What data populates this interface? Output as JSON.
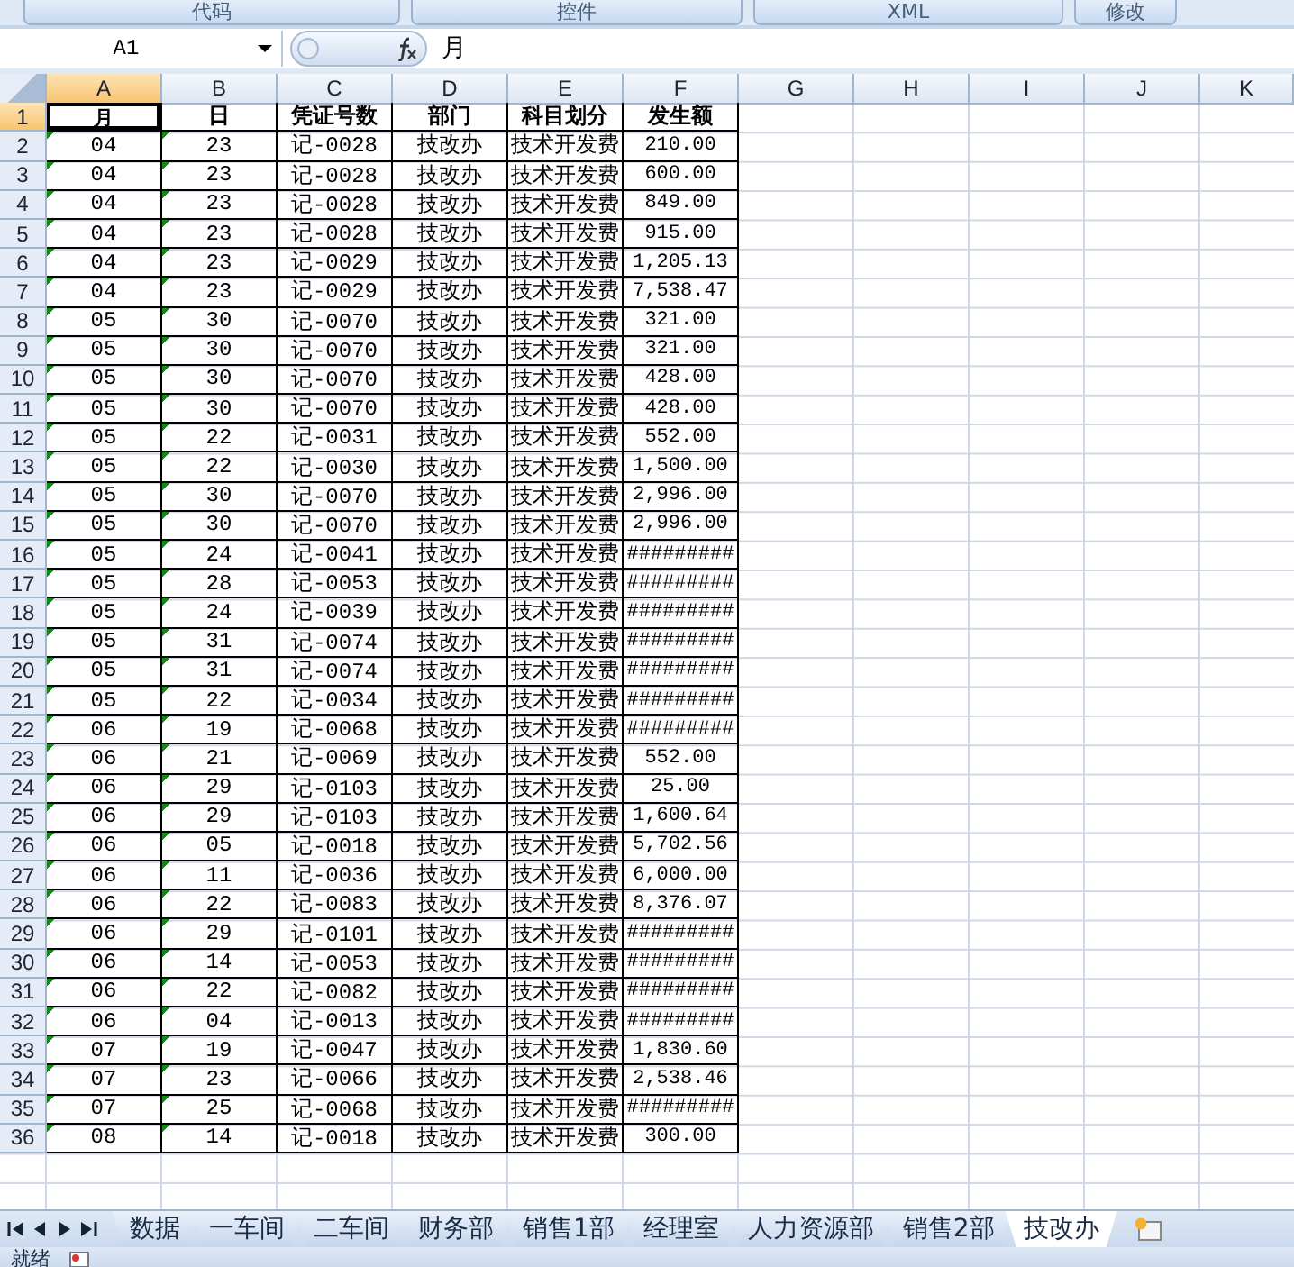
{
  "ribbon_buttons": [
    "代码",
    "控件",
    "XML",
    "修改"
  ],
  "name_box": "A1",
  "formula": "月",
  "columns": [
    {
      "label": "A",
      "selected": true
    },
    {
      "label": "B",
      "selected": false
    },
    {
      "label": "C",
      "selected": false
    },
    {
      "label": "D",
      "selected": false
    },
    {
      "label": "E",
      "selected": false
    },
    {
      "label": "F",
      "selected": false
    },
    {
      "label": "G",
      "selected": false
    },
    {
      "label": "H",
      "selected": false
    },
    {
      "label": "I",
      "selected": false
    },
    {
      "label": "J",
      "selected": false
    },
    {
      "label": "K",
      "selected": false
    }
  ],
  "rows": [
    {
      "number": "1",
      "selected": true,
      "flagged": false,
      "cells": [
        "月",
        "日",
        "凭证号数",
        "部门",
        "科目划分",
        "发生额"
      ]
    },
    {
      "number": "2",
      "selected": false,
      "flagged": true,
      "cells": [
        "04",
        "23",
        "记-0028",
        "技改办",
        "技术开发费",
        "210.00"
      ]
    },
    {
      "number": "3",
      "selected": false,
      "flagged": true,
      "cells": [
        "04",
        "23",
        "记-0028",
        "技改办",
        "技术开发费",
        "600.00"
      ]
    },
    {
      "number": "4",
      "selected": false,
      "flagged": true,
      "cells": [
        "04",
        "23",
        "记-0028",
        "技改办",
        "技术开发费",
        "849.00"
      ]
    },
    {
      "number": "5",
      "selected": false,
      "flagged": true,
      "cells": [
        "04",
        "23",
        "记-0028",
        "技改办",
        "技术开发费",
        "915.00"
      ]
    },
    {
      "number": "6",
      "selected": false,
      "flagged": true,
      "cells": [
        "04",
        "23",
        "记-0029",
        "技改办",
        "技术开发费",
        "1,205.13"
      ]
    },
    {
      "number": "7",
      "selected": false,
      "flagged": true,
      "cells": [
        "04",
        "23",
        "记-0029",
        "技改办",
        "技术开发费",
        "7,538.47"
      ]
    },
    {
      "number": "8",
      "selected": false,
      "flagged": true,
      "cells": [
        "05",
        "30",
        "记-0070",
        "技改办",
        "技术开发费",
        "321.00"
      ]
    },
    {
      "number": "9",
      "selected": false,
      "flagged": true,
      "cells": [
        "05",
        "30",
        "记-0070",
        "技改办",
        "技术开发费",
        "321.00"
      ]
    },
    {
      "number": "10",
      "selected": false,
      "flagged": true,
      "cells": [
        "05",
        "30",
        "记-0070",
        "技改办",
        "技术开发费",
        "428.00"
      ]
    },
    {
      "number": "11",
      "selected": false,
      "flagged": true,
      "cells": [
        "05",
        "30",
        "记-0070",
        "技改办",
        "技术开发费",
        "428.00"
      ]
    },
    {
      "number": "12",
      "selected": false,
      "flagged": true,
      "cells": [
        "05",
        "22",
        "记-0031",
        "技改办",
        "技术开发费",
        "552.00"
      ]
    },
    {
      "number": "13",
      "selected": false,
      "flagged": true,
      "cells": [
        "05",
        "22",
        "记-0030",
        "技改办",
        "技术开发费",
        "1,500.00"
      ]
    },
    {
      "number": "14",
      "selected": false,
      "flagged": true,
      "cells": [
        "05",
        "30",
        "记-0070",
        "技改办",
        "技术开发费",
        "2,996.00"
      ]
    },
    {
      "number": "15",
      "selected": false,
      "flagged": true,
      "cells": [
        "05",
        "30",
        "记-0070",
        "技改办",
        "技术开发费",
        "2,996.00"
      ]
    },
    {
      "number": "16",
      "selected": false,
      "flagged": true,
      "cells": [
        "05",
        "24",
        "记-0041",
        "技改办",
        "技术开发费",
        "#########"
      ]
    },
    {
      "number": "17",
      "selected": false,
      "flagged": true,
      "cells": [
        "05",
        "28",
        "记-0053",
        "技改办",
        "技术开发费",
        "#########"
      ]
    },
    {
      "number": "18",
      "selected": false,
      "flagged": true,
      "cells": [
        "05",
        "24",
        "记-0039",
        "技改办",
        "技术开发费",
        "#########"
      ]
    },
    {
      "number": "19",
      "selected": false,
      "flagged": true,
      "cells": [
        "05",
        "31",
        "记-0074",
        "技改办",
        "技术开发费",
        "#########"
      ]
    },
    {
      "number": "20",
      "selected": false,
      "flagged": true,
      "cells": [
        "05",
        "31",
        "记-0074",
        "技改办",
        "技术开发费",
        "#########"
      ]
    },
    {
      "number": "21",
      "selected": false,
      "flagged": true,
      "cells": [
        "05",
        "22",
        "记-0034",
        "技改办",
        "技术开发费",
        "#########"
      ]
    },
    {
      "number": "22",
      "selected": false,
      "flagged": true,
      "cells": [
        "06",
        "19",
        "记-0068",
        "技改办",
        "技术开发费",
        "#########"
      ]
    },
    {
      "number": "23",
      "selected": false,
      "flagged": true,
      "cells": [
        "06",
        "21",
        "记-0069",
        "技改办",
        "技术开发费",
        "552.00"
      ]
    },
    {
      "number": "24",
      "selected": false,
      "flagged": true,
      "cells": [
        "06",
        "29",
        "记-0103",
        "技改办",
        "技术开发费",
        "25.00"
      ]
    },
    {
      "number": "25",
      "selected": false,
      "flagged": true,
      "cells": [
        "06",
        "29",
        "记-0103",
        "技改办",
        "技术开发费",
        "1,600.64"
      ]
    },
    {
      "number": "26",
      "selected": false,
      "flagged": true,
      "cells": [
        "06",
        "05",
        "记-0018",
        "技改办",
        "技术开发费",
        "5,702.56"
      ]
    },
    {
      "number": "27",
      "selected": false,
      "flagged": true,
      "cells": [
        "06",
        "11",
        "记-0036",
        "技改办",
        "技术开发费",
        "6,000.00"
      ]
    },
    {
      "number": "28",
      "selected": false,
      "flagged": true,
      "cells": [
        "06",
        "22",
        "记-0083",
        "技改办",
        "技术开发费",
        "8,376.07"
      ]
    },
    {
      "number": "29",
      "selected": false,
      "flagged": true,
      "cells": [
        "06",
        "29",
        "记-0101",
        "技改办",
        "技术开发费",
        "#########"
      ]
    },
    {
      "number": "30",
      "selected": false,
      "flagged": true,
      "cells": [
        "06",
        "14",
        "记-0053",
        "技改办",
        "技术开发费",
        "#########"
      ]
    },
    {
      "number": "31",
      "selected": false,
      "flagged": true,
      "cells": [
        "06",
        "22",
        "记-0082",
        "技改办",
        "技术开发费",
        "#########"
      ]
    },
    {
      "number": "32",
      "selected": false,
      "flagged": true,
      "cells": [
        "06",
        "04",
        "记-0013",
        "技改办",
        "技术开发费",
        "#########"
      ]
    },
    {
      "number": "33",
      "selected": false,
      "flagged": true,
      "cells": [
        "07",
        "19",
        "记-0047",
        "技改办",
        "技术开发费",
        "1,830.60"
      ]
    },
    {
      "number": "34",
      "selected": false,
      "flagged": true,
      "cells": [
        "07",
        "23",
        "记-0066",
        "技改办",
        "技术开发费",
        "2,538.46"
      ]
    },
    {
      "number": "35",
      "selected": false,
      "flagged": true,
      "cells": [
        "07",
        "25",
        "记-0068",
        "技改办",
        "技术开发费",
        "#########"
      ]
    },
    {
      "number": "36",
      "selected": false,
      "flagged": true,
      "cells": [
        "08",
        "14",
        "记-0018",
        "技改办",
        "技术开发费",
        "300.00"
      ]
    }
  ],
  "sheet_tabs": [
    {
      "label": "数据",
      "selected": false
    },
    {
      "label": "一车间",
      "selected": false
    },
    {
      "label": "二车间",
      "selected": false
    },
    {
      "label": "财务部",
      "selected": false
    },
    {
      "label": "销售1部",
      "selected": false
    },
    {
      "label": "经理室",
      "selected": false
    },
    {
      "label": "人力资源部",
      "selected": false
    },
    {
      "label": "销售2部",
      "selected": false
    },
    {
      "label": "技改办",
      "selected": true
    }
  ],
  "status": "就绪"
}
